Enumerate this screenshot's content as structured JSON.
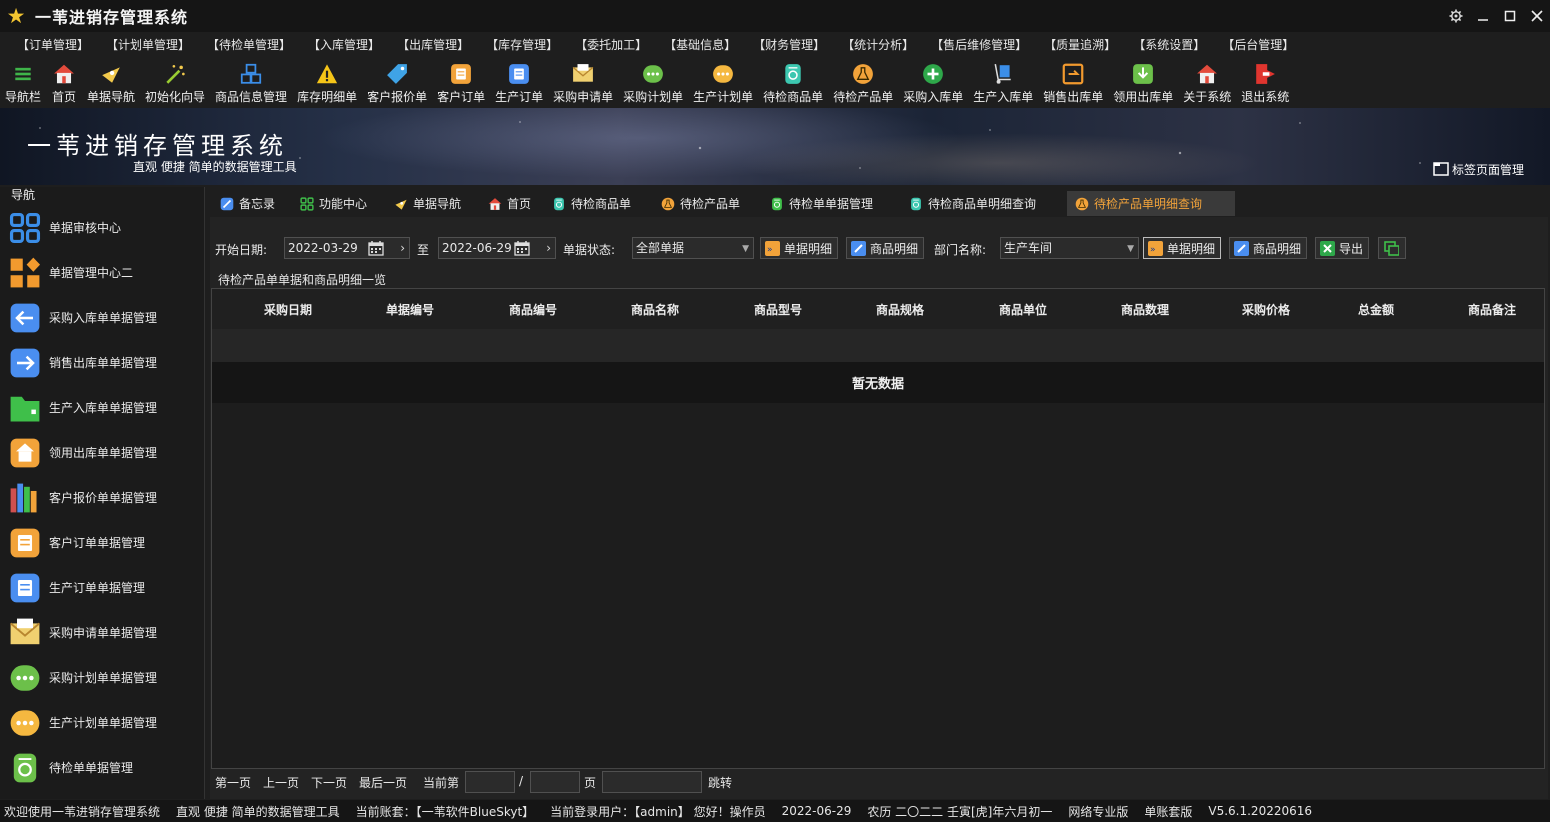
{
  "window": {
    "title": "一苇进销存管理系统",
    "controls": {
      "settings": "gear-icon",
      "minimize": "minimize-icon",
      "maximize": "maximize-icon",
      "close": "close-icon"
    }
  },
  "menu": [
    "【订单管理】",
    "【计划单管理】",
    "【待检单管理】",
    "【入库管理】",
    "【出库管理】",
    "【库存管理】",
    "【委托加工】",
    "【基础信息】",
    "【财务管理】",
    "【统计分析】",
    "【售后维修管理】",
    "【质量追溯】",
    "【系统设置】",
    "【后台管理】"
  ],
  "toolbar": [
    {
      "label": "导航栏",
      "icon": "menu-lines-icon",
      "color": "#3fb54a"
    },
    {
      "label": "首页",
      "icon": "house-icon",
      "color": "#e34b3c"
    },
    {
      "label": "单据导航",
      "icon": "compass-icon",
      "color": "#f2c94c"
    },
    {
      "label": "初始化向导",
      "icon": "magic-wand-icon",
      "color": "#9acd32"
    },
    {
      "label": "商品信息管理",
      "icon": "cubes-icon",
      "color": "#3b8ee8"
    },
    {
      "label": "库存明细单",
      "icon": "warning-triangle-icon",
      "color": "#f5c518"
    },
    {
      "label": "客户报价单",
      "icon": "price-tag-icon",
      "color": "#3fa3e6"
    },
    {
      "label": "客户订单",
      "icon": "document-icon",
      "color": "#f2a33a"
    },
    {
      "label": "生产订单",
      "icon": "document-icon",
      "color": "#4a8ef0"
    },
    {
      "label": "采购申请单",
      "icon": "envelope-icon",
      "color": "#f0d070"
    },
    {
      "label": "采购计划单",
      "icon": "chat-dots-icon",
      "color": "#6cc04a"
    },
    {
      "label": "生产计划单",
      "icon": "chat-dots-icon",
      "color": "#f5b840"
    },
    {
      "label": "待检商品单",
      "icon": "inspect-doc-icon",
      "color": "#3cc7b0"
    },
    {
      "label": "待检产品单",
      "icon": "flask-icon",
      "color": "#f2a33a"
    },
    {
      "label": "采购入库单",
      "icon": "plus-circle-icon",
      "color": "#2ea84a"
    },
    {
      "label": "生产入库单",
      "icon": "hand-truck-icon",
      "color": "#3b8ee8"
    },
    {
      "label": "销售出库单",
      "icon": "outbox-icon",
      "color": "#f29a2e"
    },
    {
      "label": "领用出库单",
      "icon": "download-box-icon",
      "color": "#6cc04a"
    },
    {
      "label": "关于系统",
      "icon": "house-icon",
      "color": "#e34b3c"
    },
    {
      "label": "退出系统",
      "icon": "exit-icon",
      "color": "#e0352f"
    }
  ],
  "banner": {
    "title": "一苇进销存管理系统",
    "subtitle": "直观 便捷 简单的数据管理工具",
    "tab_manager": "标签页面管理"
  },
  "sidebar": {
    "title": "导航",
    "items": [
      {
        "label": "单据审核中心",
        "icon": "grid-apps-icon",
        "color": "#3b8ee8"
      },
      {
        "label": "单据管理中心二",
        "icon": "grid-diamond-icon",
        "color": "#f29a2e"
      },
      {
        "label": "采购入库单单据管理",
        "icon": "arrow-left-box-icon",
        "color": "#4a8ef0"
      },
      {
        "label": "销售出库单单据管理",
        "icon": "arrow-right-box-icon",
        "color": "#4a8ef0"
      },
      {
        "label": "生产入库单单据管理",
        "icon": "folder-icon",
        "color": "#3fbf4a"
      },
      {
        "label": "领用出库单单据管理",
        "icon": "home-doc-icon",
        "color": "#f2a33a"
      },
      {
        "label": "客户报价单单据管理",
        "icon": "books-icon",
        "color": "#d05050"
      },
      {
        "label": "客户订单单据管理",
        "icon": "document-icon",
        "color": "#f2a33a"
      },
      {
        "label": "生产订单单据管理",
        "icon": "document-icon",
        "color": "#4a8ef0"
      },
      {
        "label": "采购申请单单据管理",
        "icon": "envelope-icon",
        "color": "#f0d070"
      },
      {
        "label": "采购计划单单据管理",
        "icon": "chat-dots-icon",
        "color": "#6cc04a"
      },
      {
        "label": "生产计划单单据管理",
        "icon": "chat-dots-icon",
        "color": "#f5b840"
      },
      {
        "label": "待检单单据管理",
        "icon": "inspect-doc-icon",
        "color": "#6cc04a"
      }
    ]
  },
  "tabs": [
    {
      "label": "备忘录",
      "icon": "memo-icon",
      "color": "#4a8ef0"
    },
    {
      "label": "功能中心",
      "icon": "grid-apps-icon",
      "color": "#3fbf4a"
    },
    {
      "label": "单据导航",
      "icon": "compass-icon",
      "color": "#f2c94c"
    },
    {
      "label": "首页",
      "icon": "house-icon",
      "color": "#e34b3c"
    },
    {
      "label": "待检商品单",
      "icon": "inspect-doc-icon",
      "color": "#3cc7b0"
    },
    {
      "label": "待检产品单",
      "icon": "flask-icon",
      "color": "#f2a33a"
    },
    {
      "label": "待检单单据管理",
      "icon": "inspect-doc-icon",
      "color": "#3fbf4a"
    },
    {
      "label": "待检商品单明细查询",
      "icon": "inspect-doc-icon",
      "color": "#3cc7b0"
    },
    {
      "label": "待检产品单明细查询",
      "icon": "flask-icon",
      "color": "#f2a33a",
      "active": true
    }
  ],
  "filter": {
    "start_date_label": "开始日期:",
    "start_date": "2022-03-29",
    "to_label": "至",
    "end_date": "2022-06-29",
    "status_label": "单据状态:",
    "status_value": "全部单据",
    "btn_doc_detail_1": "单据明细",
    "btn_goods_detail_1": "商品明细",
    "dept_label": "部门名称:",
    "dept_value": "生产车间",
    "btn_doc_detail_2": "单据明细",
    "btn_goods_detail_2": "商品明细",
    "btn_export": "导出"
  },
  "section_title": "待检产品单单据和商品明细一览",
  "table": {
    "columns": [
      "采购日期",
      "单据编号",
      "商品编号",
      "商品名称",
      "商品型号",
      "商品规格",
      "商品单位",
      "商品数理",
      "采购价格",
      "总金额",
      "商品备注"
    ],
    "empty_text": "暂无数据"
  },
  "pager": {
    "first": "第一页",
    "prev": "上一页",
    "next": "下一页",
    "last": "最后一页",
    "current_label": "当前第",
    "slash": "/",
    "page_unit": "页",
    "jump": "跳转"
  },
  "status": {
    "welcome": "欢迎使用一苇进销存管理系统",
    "slogan": "直观 便捷 简单的数据管理工具",
    "account": "当前账套：【一苇软件BlueSkyt】",
    "user": "当前登录用户：【admin】 您好！操作员",
    "date": "2022-06-29",
    "lunar": "农历 二〇二二 壬寅[虎]年六月初一",
    "edition": "网络专业版",
    "mode": "单账套版",
    "version": "V5.6.1.20220616"
  }
}
